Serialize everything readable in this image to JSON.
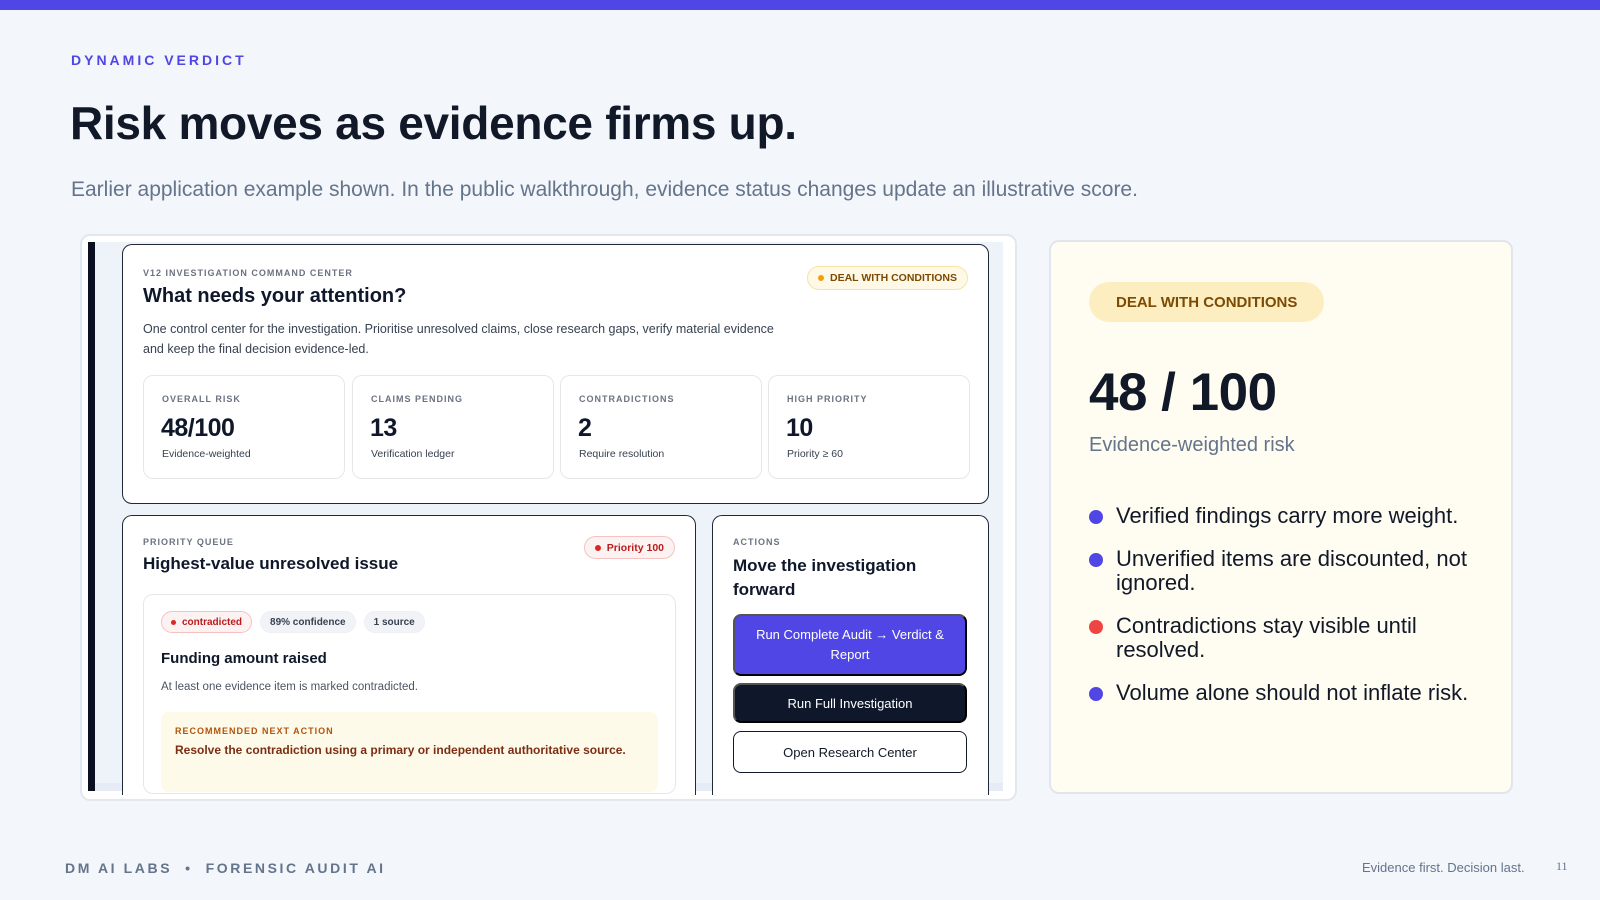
{
  "slide": {
    "eyebrow": "DYNAMIC VERDICT",
    "title": "Risk moves as evidence firms up.",
    "subtitle": "Earlier application example shown. In the public walkthrough, evidence status changes update an illustrative score.",
    "accent_color": "#4f46e5"
  },
  "screenshot": {
    "command_center": {
      "label": "V12 INVESTIGATION COMMAND CENTER",
      "heading": "What needs your attention?",
      "description": "One control center for the investigation. Prioritise unresolved claims, close research gaps, verify material evidence and keep the final decision evidence-led.",
      "status_badge": "DEAL WITH CONDITIONS",
      "metrics": [
        {
          "label": "OVERALL RISK",
          "value": "48/100",
          "sub": "Evidence-weighted"
        },
        {
          "label": "CLAIMS PENDING",
          "value": "13",
          "sub": "Verification ledger"
        },
        {
          "label": "CONTRADICTIONS",
          "value": "2",
          "sub": "Require resolution"
        },
        {
          "label": "HIGH PRIORITY",
          "value": "10",
          "sub": "Priority ≥ 60"
        }
      ]
    },
    "priority_queue": {
      "label": "PRIORITY QUEUE",
      "heading": "Highest-value unresolved issue",
      "priority_badge": "Priority 100",
      "chips": {
        "status": "contradicted",
        "confidence": "89% confidence",
        "sources": "1 source"
      },
      "issue_title": "Funding amount raised",
      "issue_desc": "At least one evidence item is marked contradicted.",
      "rec_label": "RECOMMENDED NEXT ACTION",
      "rec_text": "Resolve the contradiction using a primary or independent authoritative source."
    },
    "actions": {
      "label": "ACTIONS",
      "heading": "Move the investigation forward",
      "btn_audit": "Run Complete Audit → Verdict & Report",
      "btn_full": "Run Full Investigation",
      "btn_research": "Open Research Center"
    }
  },
  "panel": {
    "badge": "DEAL WITH CONDITIONS",
    "score": "48 / 100",
    "score_label": "Evidence-weighted risk",
    "bullets": [
      {
        "text": "Verified findings carry more weight.",
        "color": "#4f46e5"
      },
      {
        "text": "Unverified items are discounted, not ignored.",
        "color": "#4f46e5"
      },
      {
        "text": "Contradictions stay visible until resolved.",
        "color": "#ef4444"
      },
      {
        "text": "Volume alone should not inflate risk.",
        "color": "#4f46e5"
      }
    ]
  },
  "footer": {
    "left": "DM AI LABS  •  FORENSIC AUDIT AI",
    "right": "Evidence first. Decision last.",
    "page": "11"
  }
}
